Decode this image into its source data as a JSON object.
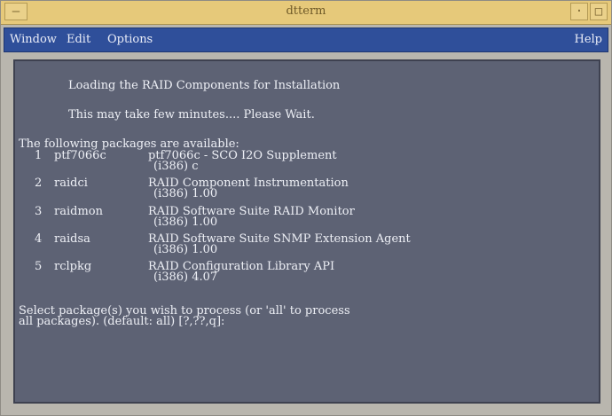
{
  "window": {
    "title": "dtterm",
    "menu_button_icon": "window-menu-icon",
    "minimize_icon": "minimize-icon",
    "maximize_icon": "maximize-icon"
  },
  "menubar": {
    "window_label": "Window",
    "edit_label": "Edit",
    "options_label": "Options",
    "help_label": "Help"
  },
  "terminal": {
    "loading": "Loading the RAID Components for Installation",
    "wait": "This may take few minutes.... Please Wait.",
    "available": "The following packages are available:",
    "packages": [
      {
        "num": "1",
        "name": "ptf7066c",
        "desc": "ptf7066c - SCO I2O Supplement",
        "ver": "(i386) c"
      },
      {
        "num": "2",
        "name": "raidci",
        "desc": "RAID Component Instrumentation",
        "ver": "(i386) 1.00"
      },
      {
        "num": "3",
        "name": "raidmon",
        "desc": "RAID Software Suite RAID Monitor",
        "ver": "(i386) 1.00"
      },
      {
        "num": "4",
        "name": "raidsa",
        "desc": "RAID Software Suite SNMP Extension Agent",
        "ver": "(i386) 1.00"
      },
      {
        "num": "5",
        "name": "rclpkg",
        "desc": "RAID Configuration Library API",
        "ver": "(i386) 4.07"
      }
    ],
    "prompt1": "Select package(s) you wish to process (or 'all' to process",
    "prompt2": "all packages). (default: all) [?,??,q]:"
  },
  "colors": {
    "titlebar": "#e6c97a",
    "menubar": "#2f4f9a",
    "terminal_bg": "#5d6274",
    "terminal_fg": "#eef0f6"
  }
}
